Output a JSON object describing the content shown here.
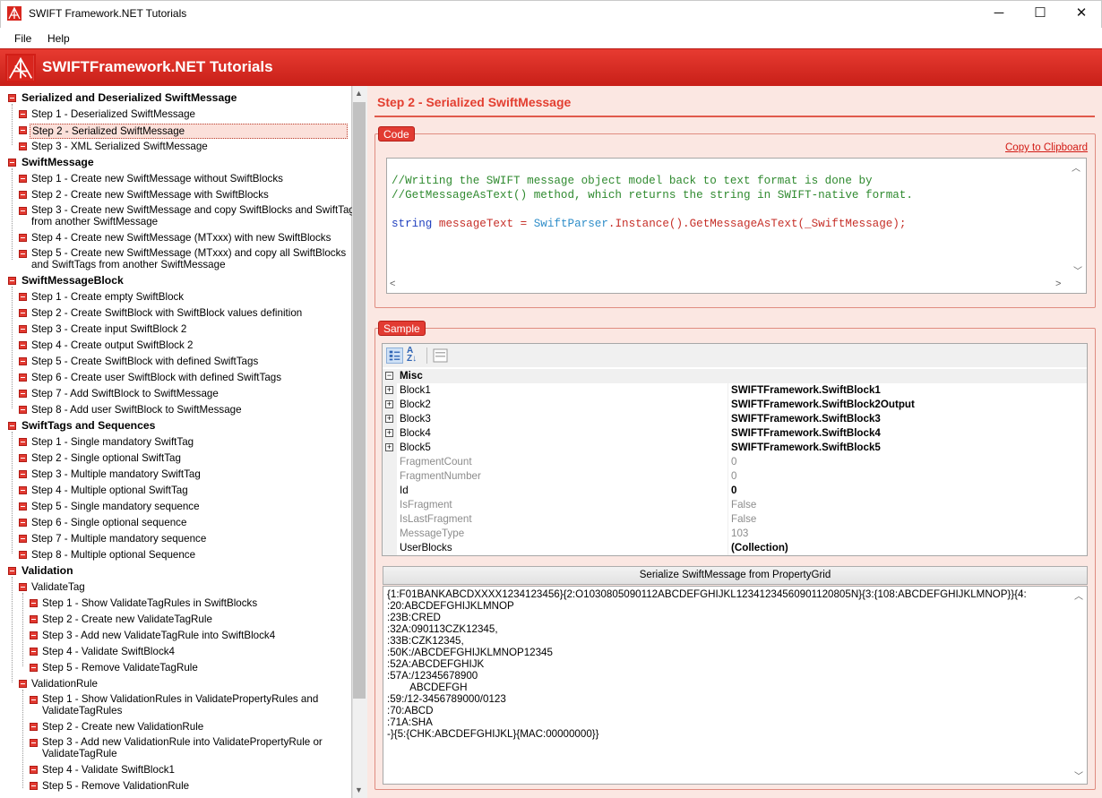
{
  "window": {
    "title": "SWIFT Framework.NET Tutorials",
    "minimize": "─",
    "maximize": "☐",
    "close": "✕"
  },
  "menu": {
    "file": "File",
    "help": "Help"
  },
  "banner": {
    "title": "SWIFTFramework.NET Tutorials"
  },
  "tree": {
    "g1": {
      "label": "Serialized and Deserialized SwiftMessage",
      "items": [
        "Step 1 - Deserialized SwiftMessage",
        "Step 2 - Serialized SwiftMessage",
        "Step 3 - XML Serialized SwiftMessage"
      ]
    },
    "g2": {
      "label": "SwiftMessage",
      "items": [
        "Step 1 - Create new SwiftMessage without SwiftBlocks",
        "Step 2 - Create new SwiftMessage with SwiftBlocks",
        "Step 3 - Create new SwiftMessage and copy SwiftBlocks and SwiftTags",
        "from another SwiftMessage",
        "Step 4 - Create new SwiftMessage (MTxxx) with new SwiftBlocks",
        "Step 5 - Create new SwiftMessage (MTxxx) and copy all SwiftBlocks",
        "and SwiftTags from another SwiftMessage"
      ]
    },
    "g3": {
      "label": "SwiftMessageBlock",
      "items": [
        "Step 1 - Create empty SwiftBlock",
        "Step 2 - Create SwiftBlock with SwiftBlock values definition",
        "Step 3 - Create input SwiftBlock 2",
        "Step 4 - Create output SwiftBlock 2",
        "Step 5 - Create SwiftBlock with defined SwiftTags",
        "Step 6 - Create user SwiftBlock with defined SwiftTags",
        "Step 7 - Add SwiftBlock to SwiftMessage",
        "Step 8 - Add user SwiftBlock to SwiftMessage"
      ]
    },
    "g4": {
      "label": "SwiftTags and Sequences",
      "items": [
        "Step 1 - Single mandatory SwiftTag",
        "Step 2 - Single optional SwiftTag",
        "Step 3 - Multiple mandatory SwiftTag",
        "Step 4 - Multiple optional SwiftTag",
        "Step 5 - Single mandatory sequence",
        "Step 6 - Single optional sequence",
        "Step 7 - Multiple mandatory sequence",
        "Step 8 - Multiple optional Sequence"
      ]
    },
    "g5": {
      "label": "Validation",
      "sub1": {
        "label": "ValidateTag",
        "items": [
          "Step 1 - Show ValidateTagRules in SwiftBlocks",
          "Step 2 - Create new ValidateTagRule",
          "Step 3 - Add new ValidateTagRule into SwiftBlock4",
          "Step 4 - Validate SwiftBlock4",
          "Step 5 - Remove ValidateTagRule"
        ]
      },
      "sub2": {
        "label": "ValidationRule",
        "items": [
          "Step 1 - Show ValidationRules in ValidatePropertyRules and",
          "ValidateTagRules",
          "Step 2 - Create new ValidationRule",
          "Step 3 - Add new ValidationRule into ValidatePropertyRule or",
          "ValidateTagRule",
          "Step 4 - Validate SwiftBlock1",
          "Step 5 - Remove ValidationRule"
        ]
      }
    }
  },
  "main": {
    "step_title": "Step 2 - Serialized SwiftMessage",
    "code_tag": "Code",
    "copy_link": "Copy to Clipboard",
    "code": {
      "line1": "//Writing the SWIFT message object model back to text format is done by",
      "line2": "//GetMessageAsText() method, which returns the string in SWIFT-native format.",
      "kw": "string",
      "var": "messageText",
      "eq": " = ",
      "cls": "SwiftParser",
      "rest": ".Instance().GetMessageAsText(_SwiftMessage);"
    },
    "sample_tag": "Sample",
    "grid": {
      "category": "Misc",
      "rows": [
        {
          "name": "Block1",
          "value": "SWIFTFramework.SwiftBlock1"
        },
        {
          "name": "Block2",
          "value": "SWIFTFramework.SwiftBlock2Output"
        },
        {
          "name": "Block3",
          "value": "SWIFTFramework.SwiftBlock3"
        },
        {
          "name": "Block4",
          "value": "SWIFTFramework.SwiftBlock4"
        },
        {
          "name": "Block5",
          "value": "SWIFTFramework.SwiftBlock5"
        },
        {
          "name": "FragmentCount",
          "value": "0"
        },
        {
          "name": "FragmentNumber",
          "value": "0"
        },
        {
          "name": "Id",
          "value": "0"
        },
        {
          "name": "IsFragment",
          "value": "False"
        },
        {
          "name": "IsLastFragment",
          "value": "False"
        },
        {
          "name": "MessageType",
          "value": "103"
        },
        {
          "name": "UserBlocks",
          "value": "(Collection)"
        }
      ]
    },
    "serialize_button": "Serialize SwiftMessage from PropertyGrid",
    "output_lines": [
      "{1:F01BANKABCDXXXX1234123456}{2:O1030805090112ABCDEFGHIJKL12341234560901120805N}{3:{108:ABCDEFGHIJKLMNOP}}{4:",
      ":20:ABCDEFGHIJKLMNOP",
      ":23B:CRED",
      ":32A:090113CZK12345,",
      ":33B:CZK12345,",
      ":50K:/ABCDEFGHIJKLMNOP12345",
      ":52A:ABCDEFGHIJK",
      ":57A:/12345678900",
      "        ABCDEFGH",
      ":59:/12-3456789000/0123",
      ":70:ABCD",
      ":71A:SHA",
      "-}{5:{CHK:ABCDEFGHIJKL}{MAC:00000000}}"
    ]
  }
}
